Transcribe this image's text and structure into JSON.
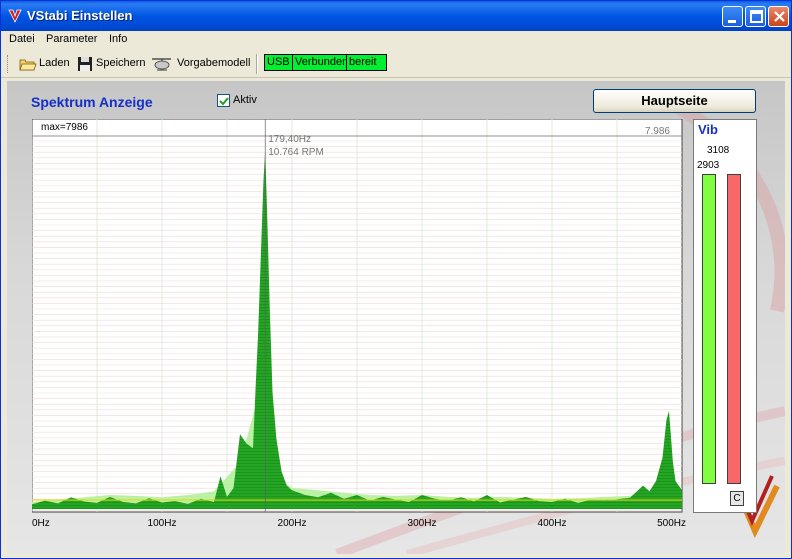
{
  "window": {
    "title": "VStabi Einstellen"
  },
  "menu": {
    "items": [
      "Datei",
      "Parameter",
      "Info"
    ]
  },
  "toolbar": {
    "load_label": "Laden",
    "save_label": "Speichern",
    "model_label": "Vorgabemodell",
    "status_usb": "USB",
    "status_connected": "Verbunden",
    "status_ready": "bereit",
    "status_color": "#00f030"
  },
  "spectrum": {
    "title": "Spektrum Anzeige",
    "active_label": "Aktiv",
    "active_checked": true,
    "main_button": "Hauptseite"
  },
  "vib": {
    "title": "Vib",
    "value_top": "3108",
    "value_left": "2903",
    "clear_label": "C",
    "green_color": "#80ff40",
    "red_color": "#f86868"
  },
  "chart_data": {
    "type": "area",
    "max_label": "max=7986",
    "max_value_label": "7.986",
    "peak_annotation": [
      "179,40Hz",
      "10.764 RPM"
    ],
    "x_tick_labels": [
      "0Hz",
      "100Hz",
      "200Hz",
      "300Hz",
      "400Hz",
      "500Hz"
    ],
    "x_ticks": [
      0,
      100,
      200,
      300,
      400,
      500
    ],
    "xlim": [
      0,
      500
    ],
    "ylim": [
      0,
      7986
    ],
    "series": [
      {
        "color": "#139a13",
        "x": [
          0,
          10,
          20,
          30,
          40,
          50,
          60,
          70,
          80,
          90,
          100,
          110,
          120,
          130,
          140,
          145,
          150,
          155,
          160,
          165,
          170,
          172,
          174,
          176,
          178,
          179.4,
          181,
          183,
          185,
          188,
          192,
          196,
          200,
          210,
          220,
          230,
          240,
          250,
          260,
          270,
          280,
          290,
          300,
          310,
          320,
          330,
          340,
          350,
          360,
          370,
          380,
          390,
          400,
          410,
          420,
          430,
          440,
          450,
          460,
          470,
          475,
          480,
          485,
          488,
          490,
          493,
          495,
          500
        ],
        "values": [
          100,
          180,
          120,
          250,
          160,
          130,
          260,
          150,
          120,
          230,
          140,
          170,
          110,
          220,
          150,
          700,
          260,
          450,
          1600,
          1400,
          1300,
          2600,
          3800,
          5400,
          7000,
          7700,
          6200,
          4200,
          2500,
          1500,
          800,
          500,
          400,
          300,
          250,
          350,
          220,
          300,
          180,
          260,
          200,
          150,
          300,
          220,
          180,
          250,
          160,
          300,
          140,
          200,
          260,
          170,
          150,
          220,
          130,
          200,
          180,
          210,
          240,
          500,
          380,
          600,
          1100,
          1900,
          2100,
          1000,
          600,
          400
        ]
      },
      {
        "color": "#b6f0a0",
        "x": [
          0,
          20,
          40,
          60,
          80,
          100,
          120,
          140,
          160,
          180,
          185,
          190,
          195,
          200,
          220,
          240,
          260,
          280,
          300,
          320,
          340,
          360,
          380,
          400,
          420,
          440,
          460,
          480,
          490,
          500
        ],
        "values": [
          150,
          200,
          250,
          300,
          280,
          250,
          300,
          380,
          1000,
          3000,
          900,
          700,
          550,
          450,
          400,
          350,
          300,
          280,
          300,
          260,
          240,
          260,
          240,
          220,
          230,
          260,
          280,
          400,
          900,
          300
        ]
      }
    ]
  }
}
